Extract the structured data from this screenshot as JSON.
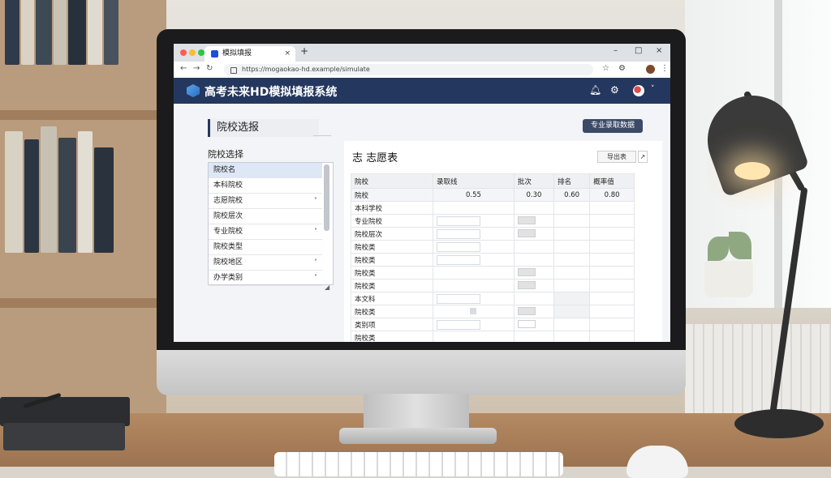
{
  "browser": {
    "tab_title": "模拟填报",
    "tab_close": "×",
    "new_tab": "+",
    "url": "https://mogaokao-hd.example/simulate",
    "window_controls": [
      "–",
      "□",
      "×"
    ],
    "toolbar_icons": [
      "☆",
      "⚙",
      "⋮"
    ]
  },
  "header": {
    "title": "高考未来HD模拟填报系统",
    "icons": [
      "bell-icon",
      "gear-icon",
      "user-avatar"
    ],
    "dropdown": "˅"
  },
  "left_panel": {
    "section_title": "院校选报",
    "list_label": "院校选择",
    "items": [
      {
        "label": "院校名",
        "selected": true,
        "chevron": ""
      },
      {
        "label": "本科院校",
        "selected": false,
        "chevron": ""
      },
      {
        "label": "志愿院校",
        "selected": false,
        "chevron": "˅"
      },
      {
        "label": "院校层次",
        "selected": false,
        "chevron": ""
      },
      {
        "label": "专业院校",
        "selected": false,
        "chevron": "˅"
      },
      {
        "label": "院校类型",
        "selected": false,
        "chevron": ""
      },
      {
        "label": "院校地区",
        "selected": false,
        "chevron": "˅"
      },
      {
        "label": "办学类别",
        "selected": false,
        "chevron": "˅"
      }
    ]
  },
  "right_panel": {
    "top_button": "专业录取数据",
    "card_title": "志  志愿表",
    "export_button": "导出表",
    "collapse_button": "↗",
    "columns": [
      "院校",
      "录取线",
      "批次",
      "排名",
      "概率值"
    ],
    "first_row": [
      "院校",
      "0.55",
      "0.30",
      "0.60",
      "0.80"
    ],
    "rows": [
      {
        "label": "本科学校"
      },
      {
        "label": "专业院校"
      },
      {
        "label": "院校层次"
      },
      {
        "label": "院校类"
      },
      {
        "label": "院校类"
      },
      {
        "label": "院校类"
      },
      {
        "label": "院校类"
      },
      {
        "label": "本文科"
      },
      {
        "label": "院校类"
      },
      {
        "label": "类别项"
      },
      {
        "label": "院校类"
      }
    ]
  },
  "colors": {
    "header": "#24375e",
    "accent": "#1d4ed8",
    "button": "#3b4a66"
  }
}
